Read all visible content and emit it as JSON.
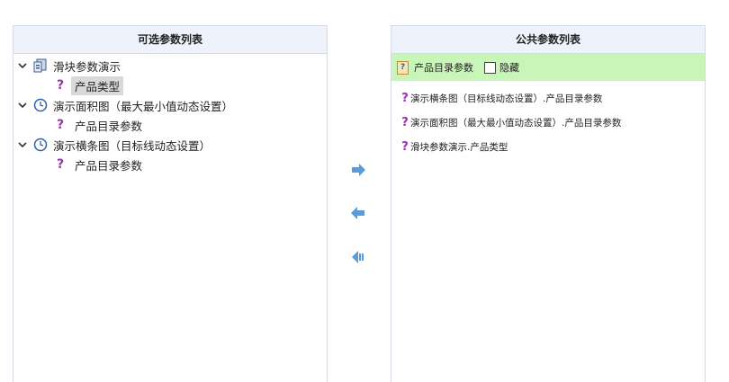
{
  "left_panel": {
    "title": "可选参数列表",
    "tree": [
      {
        "label": "滑块参数演示",
        "icon": "slider-widget-icon",
        "children": [
          {
            "label": "产品类型",
            "selected": true
          }
        ]
      },
      {
        "label": "演示面积图（最大最小值动态设置）",
        "icon": "clock-icon",
        "children": [
          {
            "label": "产品目录参数",
            "selected": false
          }
        ]
      },
      {
        "label": "演示横条图（目标线动态设置）",
        "icon": "clock-icon",
        "children": [
          {
            "label": "产品目录参数",
            "selected": false
          }
        ]
      }
    ]
  },
  "arrows": [
    "arrow-right-icon",
    "arrow-left-icon",
    "arrow-left-all-icon"
  ],
  "right_panel": {
    "title": "公共参数列表",
    "public_param": {
      "label": "产品目录参数",
      "hide_label": "隐藏",
      "hidden": false
    },
    "items": [
      "演示横条图（目标线动态设置）.产品目录参数",
      "演示面积图（最大最小值动态设置）.产品目录参数",
      "滑块参数演示.产品类型"
    ]
  },
  "colors": {
    "header_bg": "#eef3fb",
    "public_row_bg": "#c8f5b8",
    "question_mark": "#9b2fb5",
    "arrow": "#5b9bd8",
    "selected_bg": "#d9d9d9"
  }
}
